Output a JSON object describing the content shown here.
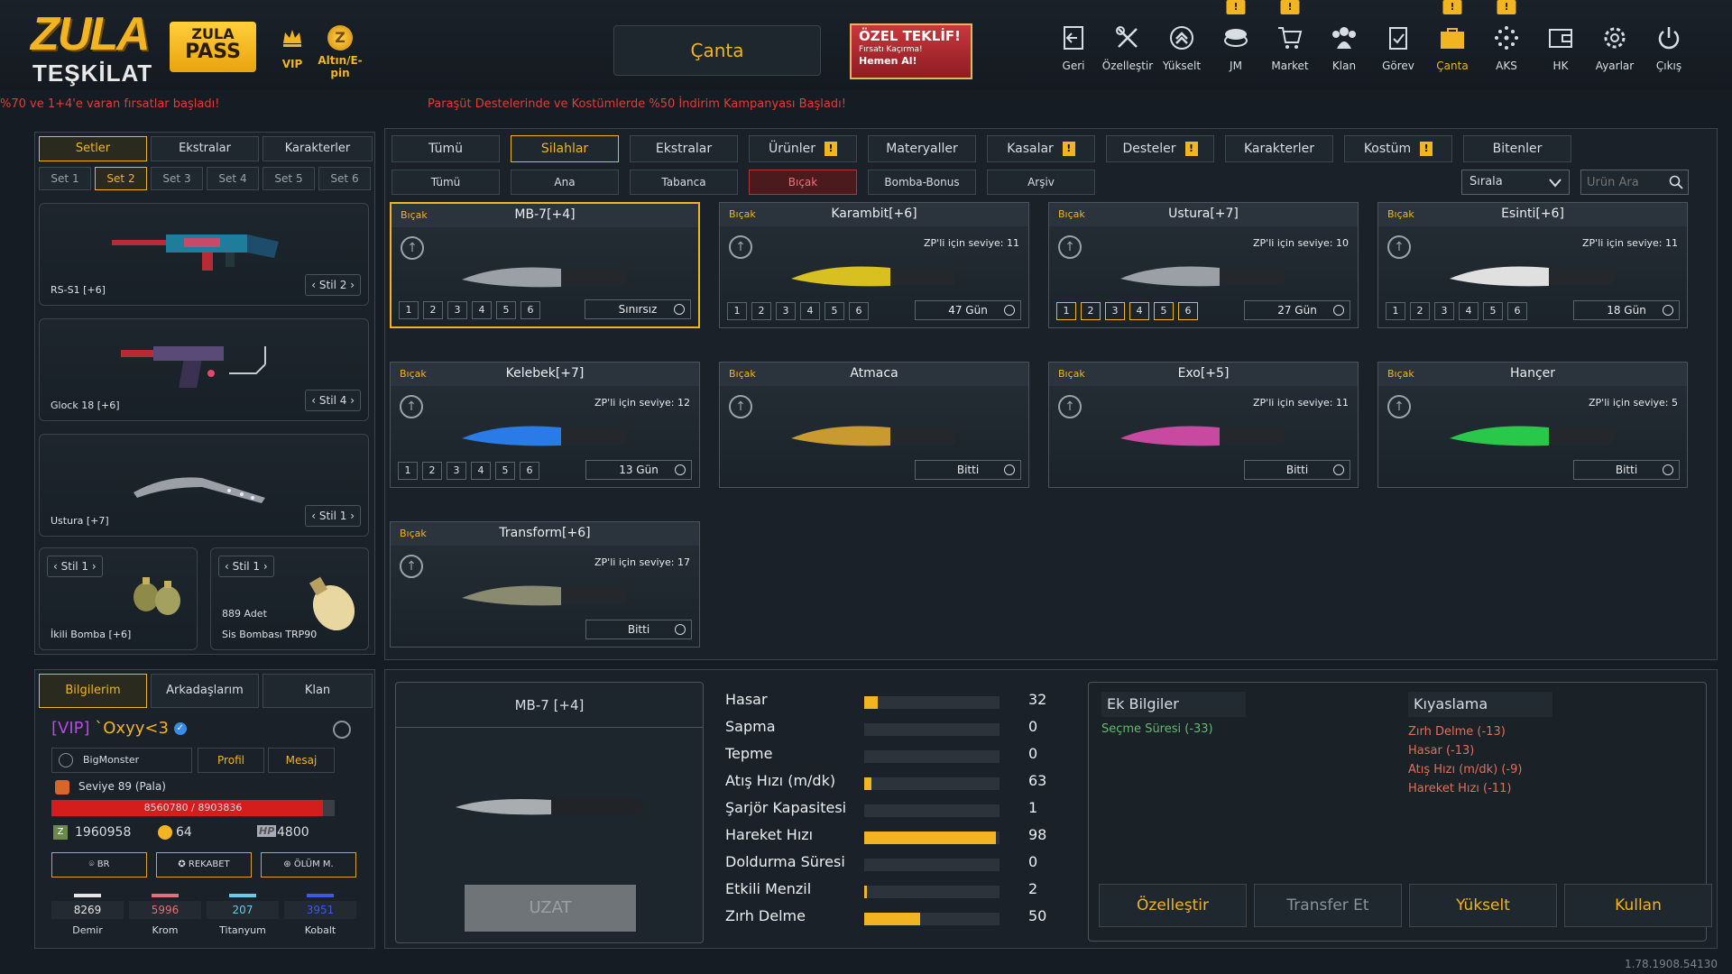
{
  "logo": {
    "line1": "ZULA",
    "line2": "TEŞKİLAT"
  },
  "pass": {
    "line1": "ZULA",
    "line2": "PASS"
  },
  "currency": {
    "vip_label": "VIP",
    "altin_label": "Altın/E-pin",
    "coin_glyph": "Z"
  },
  "canta_button": "Çanta",
  "offer": {
    "title": "ÖZEL TEKLİF!",
    "subtitle": "Fırsatı Kaçırma!",
    "cta": "Hemen Al!"
  },
  "topnav": [
    {
      "label": "Geri",
      "icon": "back-icon"
    },
    {
      "label": "Özelleştir",
      "icon": "tools-icon"
    },
    {
      "label": "Yükselt",
      "icon": "rank-up-icon"
    },
    {
      "label": "JM",
      "icon": "coins-icon",
      "badge": "!"
    },
    {
      "label": "Market",
      "icon": "cart-icon",
      "badge": "!"
    },
    {
      "label": "Klan",
      "icon": "clan-icon"
    },
    {
      "label": "Görev",
      "icon": "clipboard-icon"
    },
    {
      "label": "Çanta",
      "icon": "bag-icon",
      "badge": "!"
    },
    {
      "label": "AKS",
      "icon": "dots-icon",
      "badge": "!"
    },
    {
      "label": "HK",
      "icon": "wallet-icon"
    },
    {
      "label": "Ayarlar",
      "icon": "gear-icon"
    },
    {
      "label": "Çıkış",
      "icon": "power-icon"
    }
  ],
  "ticker": {
    "left": "%70 ve 1+4'e varan fırsatlar başladı!",
    "right": "Paraşüt Destelerinde ve Kostümlerde %50 İndirim Kampanyası Başladı!"
  },
  "left_tabs": [
    "Setler",
    "Ekstralar",
    "Karakterler"
  ],
  "set_tabs": [
    "Set 1",
    "Set 2",
    "Set 3",
    "Set 4",
    "Set 5",
    "Set 6"
  ],
  "slots": {
    "primary": {
      "name": "RS-S1 [+6]",
      "stil": "Stil 2"
    },
    "secondary": {
      "name": "Glock 18 [+6]",
      "stil": "Stil 4"
    },
    "melee": {
      "name": "Ustura [+7]",
      "stil": "Stil 1"
    },
    "grenade1": {
      "name": "İkili Bomba [+6]",
      "stil": "Stil 1"
    },
    "grenade2": {
      "count": "889 Adet",
      "name": "Sis Bombası TRP90",
      "stil": "Stil 1"
    }
  },
  "info_tabs": [
    "Bilgilerim",
    "Arkadaşlarım",
    "Klan"
  ],
  "profile": {
    "vip_tag": "[VIP]",
    "username": "`Oxyy<3",
    "clan": "BigMonster",
    "profile_btn": "Profil",
    "message_btn": "Mesaj",
    "level": "Seviye 89 (Pala)",
    "xp": "8560780 / 8903836",
    "xp_progress": 0.96,
    "zp": "1960958",
    "gold": "64",
    "hp_tag": "HP",
    "hp": "4800",
    "modes": [
      "BR",
      "REKABET",
      "ÖLÜM M."
    ],
    "materials": [
      {
        "value": "8269",
        "label": "Demir",
        "color": "#e6e6e6"
      },
      {
        "value": "5996",
        "label": "Krom",
        "color": "#e4707a"
      },
      {
        "value": "207",
        "label": "Titanyum",
        "color": "#6cc8e8"
      },
      {
        "value": "3951",
        "label": "Kobalt",
        "color": "#3a5ae8"
      }
    ]
  },
  "categories": [
    {
      "label": "Tümü"
    },
    {
      "label": "Silahlar"
    },
    {
      "label": "Ekstralar"
    },
    {
      "label": "Ürünler",
      "warn": "!"
    },
    {
      "label": "Materyaller"
    },
    {
      "label": "Kasalar",
      "warn": "!"
    },
    {
      "label": "Desteler",
      "warn": "!"
    },
    {
      "label": "Karakterler"
    },
    {
      "label": "Kostüm",
      "warn": "!"
    },
    {
      "label": "Bitenler"
    }
  ],
  "subcategories": [
    "Tümü",
    "Ana",
    "Tabanca",
    "Bıçak",
    "Bomba-Bonus",
    "Arşiv"
  ],
  "sort_label": "Sırala",
  "search_placeholder": "Ürün Ara",
  "items": [
    {
      "type": "Bıçak",
      "name": "MB-7[+4]",
      "level": "",
      "duration": "Sınırsız",
      "upgrades": [
        "1",
        "2",
        "3",
        "4",
        "5",
        "6"
      ],
      "active": 0
    },
    {
      "type": "Bıçak",
      "name": "Karambit[+6]",
      "level": "ZP'li için seviye: 11",
      "duration": "47 Gün",
      "upgrades": [
        "1",
        "2",
        "3",
        "4",
        "5",
        "6"
      ],
      "active": 0
    },
    {
      "type": "Bıçak",
      "name": "Ustura[+7]",
      "level": "ZP'li için seviye: 10",
      "duration": "27 Gün",
      "upgrades": [
        "1",
        "2",
        "3",
        "4",
        "5",
        "6"
      ],
      "active": 6
    },
    {
      "type": "Bıçak",
      "name": "Esinti[+6]",
      "level": "ZP'li için seviye: 11",
      "duration": "18 Gün",
      "upgrades": [
        "1",
        "2",
        "3",
        "4",
        "5",
        "6"
      ],
      "active": 0
    },
    {
      "type": "Bıçak",
      "name": "Kelebek[+7]",
      "level": "ZP'li için seviye: 12",
      "duration": "13 Gün",
      "upgrades": [
        "1",
        "2",
        "3",
        "4",
        "5",
        "6"
      ],
      "active": 0
    },
    {
      "type": "Bıçak",
      "name": "Atmaca",
      "level": "",
      "duration": "Bitti",
      "upgrades": [],
      "active": 0
    },
    {
      "type": "Bıçak",
      "name": "Exo[+5]",
      "level": "ZP'li için seviye: 11",
      "duration": "Bitti",
      "upgrades": [],
      "active": 0
    },
    {
      "type": "Bıçak",
      "name": "Hançer",
      "level": "ZP'li için seviye: 5",
      "duration": "Bitti",
      "upgrades": [],
      "active": 0
    },
    {
      "type": "Bıçak",
      "name": "Transform[+6]",
      "level": "ZP'li için seviye: 17",
      "duration": "Bitti",
      "upgrades": [],
      "active": 0
    }
  ],
  "selected": {
    "name": "MB-7 [+4]",
    "extend_btn": "UZAT"
  },
  "stats": [
    {
      "label": "Hasar",
      "value": 32
    },
    {
      "label": "Sapma",
      "value": 0
    },
    {
      "label": "Tepme",
      "value": 0
    },
    {
      "label": "Atış Hızı (m/dk)",
      "value": 63
    },
    {
      "label": "Şarjör Kapasitesi",
      "value": 1
    },
    {
      "label": "Hareket Hızı",
      "value": 98
    },
    {
      "label": "Doldurma Süresi",
      "value": 0
    },
    {
      "label": "Etkili Menzil",
      "value": 2
    },
    {
      "label": "Zırh Delme",
      "value": 50
    }
  ],
  "stat_fills": [
    0.1,
    0,
    0,
    0.05,
    0,
    0.97,
    0,
    0.02,
    0.41
  ],
  "extra_info": {
    "title": "Ek Bilgiler",
    "lines": [
      "Seçme Süresi (-33)"
    ]
  },
  "compare": {
    "title": "Kıyaslama",
    "lines": [
      "Zırh Delme (-13)",
      "Hasar (-13)",
      "Atış Hızı (m/dk) (-9)",
      "Hareket Hızı (-11)"
    ]
  },
  "actions": [
    "Özelleştir",
    "Transfer Et",
    "Yükselt",
    "Kullan"
  ],
  "version": "1.78.1908.54130",
  "colors": {
    "accent": "#f2b420",
    "danger": "#e33b38",
    "green": "#5fbf6a",
    "red": "#e0705c"
  }
}
